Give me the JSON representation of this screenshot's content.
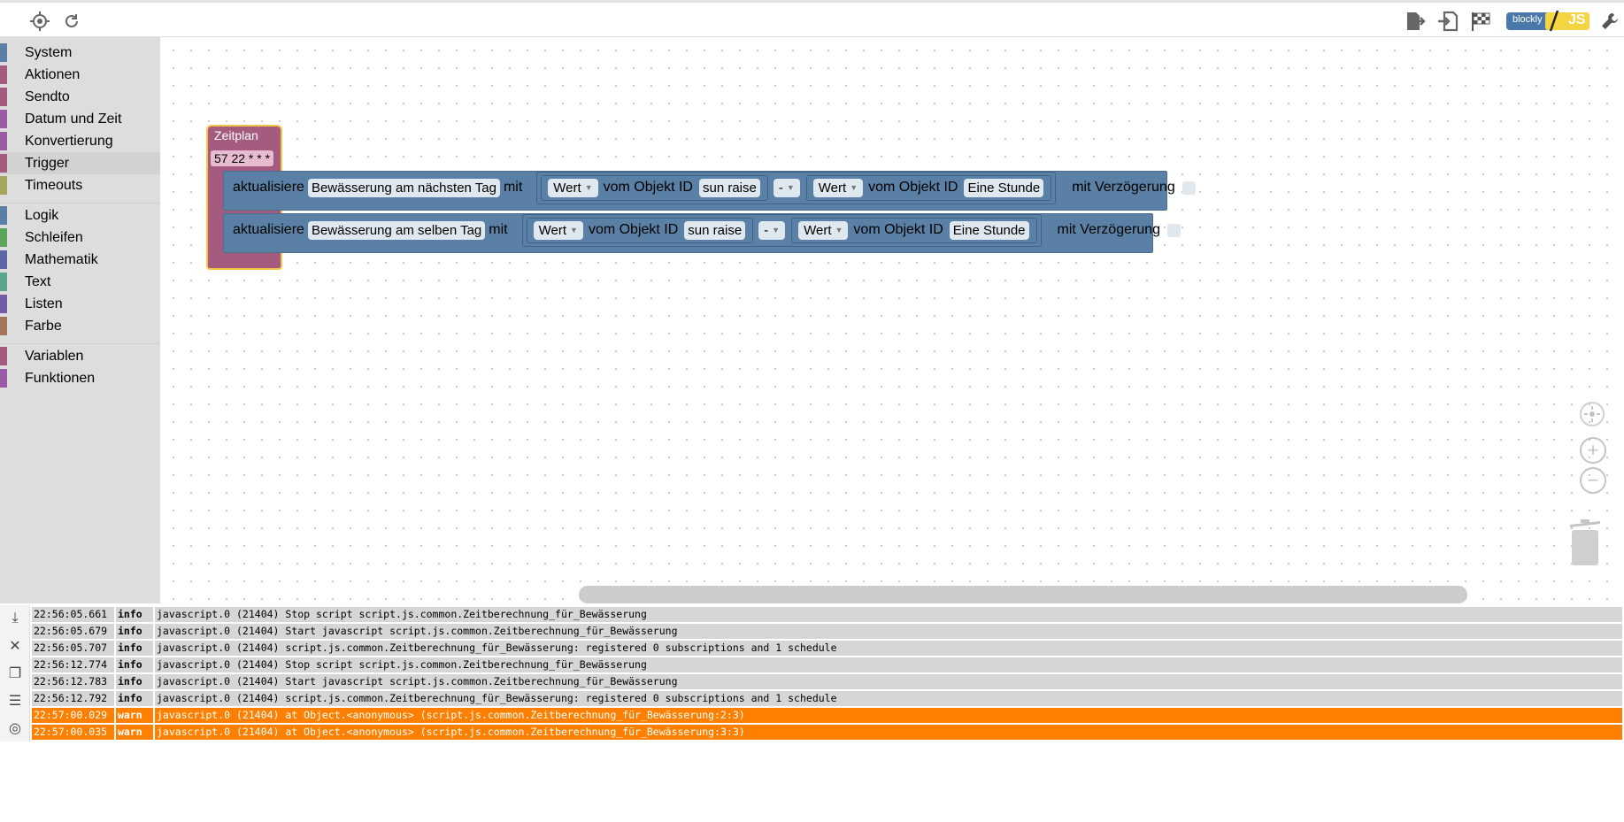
{
  "toolbar": {
    "left_icons": [
      "crosshair-icon",
      "refresh-icon"
    ],
    "right_icons": [
      "export-icon",
      "import-icon",
      "checkered-flag-icon",
      "blockly-js-toggle",
      "wrench-icon"
    ],
    "blockly_label": "blockly",
    "js_label": "JS"
  },
  "toolbox": {
    "groups": [
      [
        {
          "label": "System",
          "color": "#5b80a5"
        },
        {
          "label": "Aktionen",
          "color": "#a55b80"
        },
        {
          "label": "Sendto",
          "color": "#a55b80"
        },
        {
          "label": "Datum und Zeit",
          "color": "#995ba5"
        },
        {
          "label": "Konvertierung",
          "color": "#995ba5"
        },
        {
          "label": "Trigger",
          "color": "#a55b80",
          "selected": true
        },
        {
          "label": "Timeouts",
          "color": "#a5a55b"
        }
      ],
      [
        {
          "label": "Logik",
          "color": "#5b80a5"
        },
        {
          "label": "Schleifen",
          "color": "#5ba55b"
        },
        {
          "label": "Mathematik",
          "color": "#5b67a5"
        },
        {
          "label": "Text",
          "color": "#5ba58c"
        },
        {
          "label": "Listen",
          "color": "#745ba5"
        },
        {
          "label": "Farbe",
          "color": "#a5745b"
        }
      ],
      [
        {
          "label": "Variablen",
          "color": "#a55b80"
        },
        {
          "label": "Funktionen",
          "color": "#995ba5"
        }
      ]
    ]
  },
  "workspace": {
    "schedule_block": {
      "title": "Zeitplan",
      "cron": "57 22 * * *"
    },
    "update_blocks": [
      {
        "verb": "aktualisiere",
        "target": "Bewässerung am nächsten Tag",
        "with": "mit",
        "left": {
          "prop": "Wert",
          "of": "vom Objekt ID",
          "id": "sun raise"
        },
        "op": "-",
        "right": {
          "prop": "Wert",
          "of": "vom Objekt ID",
          "id": "Eine Stunde"
        },
        "delay_label": "mit Verzögerung"
      },
      {
        "verb": "aktualisiere",
        "target": "Bewässerung am selben Tag",
        "with": "mit",
        "left": {
          "prop": "Wert",
          "of": "vom Objekt ID",
          "id": "sun raise"
        },
        "op": "-",
        "right": {
          "prop": "Wert",
          "of": "vom Objekt ID",
          "id": "Eine Stunde"
        },
        "delay_label": "mit Verzögerung"
      }
    ],
    "controls": [
      "center-icon",
      "zoom-in-icon",
      "zoom-out-icon",
      "trash-icon"
    ]
  },
  "log": {
    "tools": [
      "download-icon",
      "delete-icon",
      "copy-icon",
      "list-icon",
      "hide-icon"
    ],
    "rows": [
      {
        "time": "22:56:05.661",
        "severity": "info",
        "message": "javascript.0 (21404) Stop script script.js.common.Zeitberechnung_für_Bewässerung"
      },
      {
        "time": "22:56:05.679",
        "severity": "info",
        "message": "javascript.0 (21404) Start javascript script.js.common.Zeitberechnung_für_Bewässerung"
      },
      {
        "time": "22:56:05.707",
        "severity": "info",
        "message": "javascript.0 (21404) script.js.common.Zeitberechnung_für_Bewässerung: registered 0 subscriptions and 1 schedule"
      },
      {
        "time": "22:56:12.774",
        "severity": "info",
        "message": "javascript.0 (21404) Stop script script.js.common.Zeitberechnung_für_Bewässerung"
      },
      {
        "time": "22:56:12.783",
        "severity": "info",
        "message": "javascript.0 (21404) Start javascript script.js.common.Zeitberechnung_für_Bewässerung"
      },
      {
        "time": "22:56:12.792",
        "severity": "info",
        "message": "javascript.0 (21404) script.js.common.Zeitberechnung_für_Bewässerung: registered 0 subscriptions and 1 schedule"
      },
      {
        "time": "22:57:00.029",
        "severity": "warn",
        "message": "javascript.0 (21404) at Object.<anonymous> (script.js.common.Zeitberechnung_für_Bewässerung:2:3)"
      },
      {
        "time": "22:57:00.035",
        "severity": "warn",
        "message": "javascript.0 (21404) at Object.<anonymous> (script.js.common.Zeitberechnung_für_Bewässerung:3:3)"
      }
    ],
    "colors": {
      "info_bg": "#d6d6d6",
      "warn_bg": "#ff8000"
    }
  }
}
